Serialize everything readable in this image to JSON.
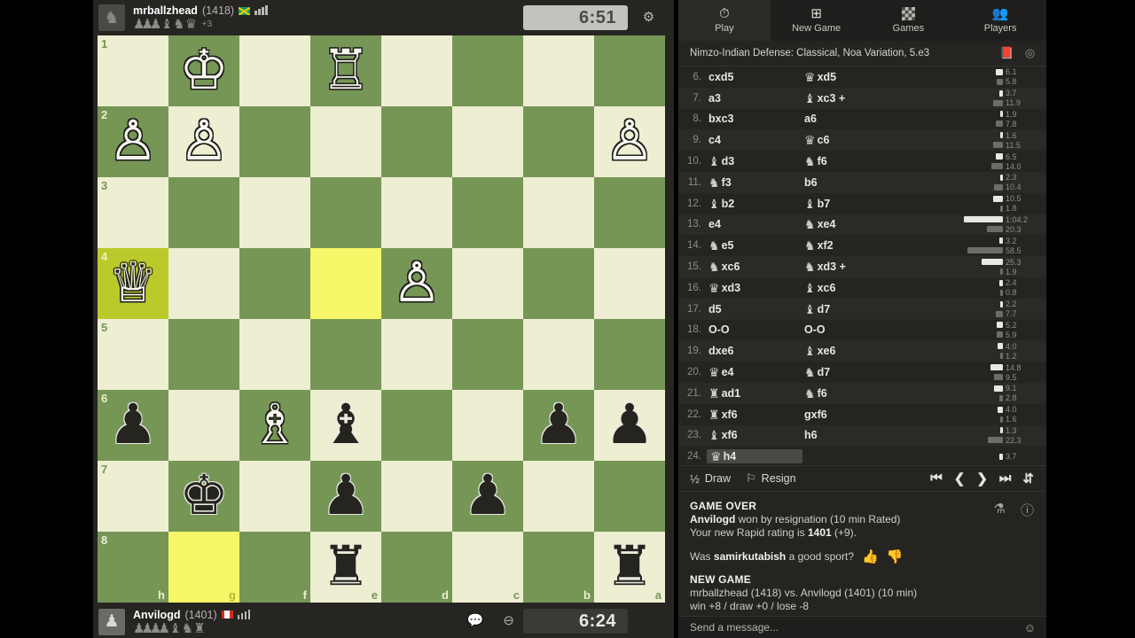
{
  "nav_tabs": [
    {
      "label": "Play",
      "icon": "stopwatch-icon",
      "active": true
    },
    {
      "label": "New Game",
      "icon": "plus-square-icon",
      "active": false
    },
    {
      "label": "Games",
      "icon": "chessboard-icon",
      "active": false
    },
    {
      "label": "Players",
      "icon": "people-icon",
      "active": false
    }
  ],
  "opening": {
    "name": "Nimzo-Indian Defense: Classical, Noa Variation, 5.e3",
    "book_icon": "book-icon",
    "analysis_icon": "compass-icon"
  },
  "players": {
    "top": {
      "name": "mrballzhead",
      "rating": "(1418)",
      "flag": "jamaica",
      "clock": "6:51",
      "clock_active": true,
      "captured": "♟♟♟ ♝ ♞ ♛",
      "advantage": "+3"
    },
    "bottom": {
      "name": "Anvilogd",
      "rating": "(1401)",
      "flag": "canada",
      "clock": "6:24",
      "clock_active": false,
      "captured": "♟♟♟♟ ♝ ♞ ♜",
      "advantage": ""
    }
  },
  "board": {
    "orientation": "black",
    "file_labels": [
      "h",
      "g",
      "f",
      "e",
      "d",
      "c",
      "b",
      "a"
    ],
    "rank_labels": [
      "1",
      "2",
      "3",
      "4",
      "5",
      "6",
      "7",
      "8"
    ],
    "highlighted": [
      "h4",
      "e4",
      "g8"
    ],
    "squares": [
      [
        null,
        "wK",
        null,
        "wR",
        null,
        null,
        null,
        null
      ],
      [
        "wP",
        "wP",
        null,
        null,
        null,
        null,
        null,
        "wP"
      ],
      [
        null,
        null,
        null,
        null,
        null,
        null,
        null,
        null
      ],
      [
        "wQ",
        null,
        null,
        null,
        "wP",
        null,
        null,
        null
      ],
      [
        null,
        null,
        null,
        null,
        null,
        null,
        null,
        null
      ],
      [
        "bP",
        null,
        "wB",
        "bB",
        null,
        null,
        "bP",
        "bP"
      ],
      [
        null,
        "bK",
        null,
        "bP",
        null,
        "bP",
        null,
        null
      ],
      [
        null,
        null,
        null,
        "bR",
        null,
        null,
        null,
        "bR"
      ]
    ]
  },
  "moves": [
    {
      "n": "6.",
      "w_pc": "",
      "w": "cxd5",
      "b_pc": "♛",
      "b": "xd5",
      "wt": "6.1",
      "bt": "5.8",
      "wbar": 8,
      "bbar": 7
    },
    {
      "n": "7.",
      "w_pc": "",
      "w": "a3",
      "b_pc": "♝",
      "b": "xc3 +",
      "wt": "3.7",
      "bt": "11.9",
      "wbar": 4,
      "bbar": 11
    },
    {
      "n": "8.",
      "w_pc": "",
      "w": "bxc3",
      "b_pc": "",
      "b": "a6",
      "wt": "1.9",
      "bt": "7.8",
      "wbar": 3,
      "bbar": 8
    },
    {
      "n": "9.",
      "w_pc": "",
      "w": "c4",
      "b_pc": "♛",
      "b": "c6",
      "wt": "1.6",
      "bt": "11.5",
      "wbar": 3,
      "bbar": 11
    },
    {
      "n": "10.",
      "w_pc": "♝",
      "w": "d3",
      "b_pc": "♞",
      "b": "f6",
      "wt": "6.5",
      "bt": "14.0",
      "wbar": 8,
      "bbar": 13
    },
    {
      "n": "11.",
      "w_pc": "♞",
      "w": "f3",
      "b_pc": "",
      "b": "b6",
      "wt": "2.3",
      "bt": "10.4",
      "wbar": 3,
      "bbar": 10
    },
    {
      "n": "12.",
      "w_pc": "♝",
      "w": "b2",
      "b_pc": "♝",
      "b": "b7",
      "wt": "10.5",
      "bt": "1.8",
      "wbar": 11,
      "bbar": 3
    },
    {
      "n": "13.",
      "w_pc": "",
      "w": "e4",
      "b_pc": "♞",
      "b": "xe4",
      "wt": "1:04.2",
      "bt": "20.3",
      "wbar": 44,
      "bbar": 18
    },
    {
      "n": "14.",
      "w_pc": "♞",
      "w": "e5",
      "b_pc": "♞",
      "b": "xf2",
      "wt": "3.2",
      "bt": "58.5",
      "wbar": 4,
      "bbar": 40
    },
    {
      "n": "15.",
      "w_pc": "♞",
      "w": "xc6",
      "b_pc": "♞",
      "b": "xd3 +",
      "wt": "25.3",
      "bt": "1.9",
      "wbar": 24,
      "bbar": 3
    },
    {
      "n": "16.",
      "w_pc": "♛",
      "w": "xd3",
      "b_pc": "♝",
      "b": "xc6",
      "wt": "2.4",
      "bt": "0.8",
      "wbar": 4,
      "bbar": 3
    },
    {
      "n": "17.",
      "w_pc": "",
      "w": "d5",
      "b_pc": "♝",
      "b": "d7",
      "wt": "2.2",
      "bt": "7.7",
      "wbar": 3,
      "bbar": 8
    },
    {
      "n": "18.",
      "w_pc": "",
      "w": "O-O",
      "b_pc": "",
      "b": "O-O",
      "wt": "5.2",
      "bt": "5.9",
      "wbar": 7,
      "bbar": 7
    },
    {
      "n": "19.",
      "w_pc": "",
      "w": "dxe6",
      "b_pc": "♝",
      "b": "xe6",
      "wt": "4.0",
      "bt": "1.2",
      "wbar": 6,
      "bbar": 3
    },
    {
      "n": "20.",
      "w_pc": "♛",
      "w": "e4",
      "b_pc": "♞",
      "b": "d7",
      "wt": "14.8",
      "bt": "9.5",
      "wbar": 14,
      "bbar": 10
    },
    {
      "n": "21.",
      "w_pc": "♜",
      "w": "ad1",
      "b_pc": "♞",
      "b": "f6",
      "wt": "9.1",
      "bt": "2.8",
      "wbar": 10,
      "bbar": 4
    },
    {
      "n": "22.",
      "w_pc": "♜",
      "w": "xf6",
      "b_pc": "",
      "b": "gxf6",
      "wt": "4.0",
      "bt": "1.6",
      "wbar": 6,
      "bbar": 3
    },
    {
      "n": "23.",
      "w_pc": "♝",
      "w": "xf6",
      "b_pc": "",
      "b": "h6",
      "wt": "1.3",
      "bt": "22.3",
      "wbar": 3,
      "bbar": 17
    },
    {
      "n": "24.",
      "w_pc": "♛",
      "w": "h4",
      "b_pc": "",
      "b": "",
      "wt": "3.7",
      "bt": "",
      "wbar": 4,
      "bbar": 0
    }
  ],
  "selected_move": "24. ♛h4",
  "actions": {
    "draw_label": "Draw",
    "draw_icon": "half-icon",
    "resign_label": "Resign",
    "resign_icon": "flag-icon",
    "nav_first": "⏮",
    "nav_prev": "❮",
    "nav_next": "❯",
    "nav_last": "⏭",
    "nav_flip": "⇵"
  },
  "game_over": {
    "title": "GAME OVER",
    "result_winner": "Anvilogd",
    "result_rest": " won by resignation (10 min Rated)",
    "rating_prefix": "Your new Rapid rating is ",
    "rating_value": "1401",
    "rating_suffix": " (+9).",
    "sport_prefix": "Was ",
    "sport_name": "samirkutabish",
    "sport_suffix": " a good sport?",
    "thumbs_up": "👍",
    "thumbs_down": "👎",
    "new_game_title": "NEW GAME",
    "new_game_players": "mrballzhead (1418) vs. Anvilogd (1401) (10 min)",
    "new_game_terms": "win +8 / draw +0 / lose -8",
    "share_icon": "share-icon",
    "info_icon": "info-icon"
  },
  "chat": {
    "placeholder": "Send a message...",
    "emoji_icon": "smiley-icon"
  },
  "colors": {
    "board_light": "#eeeed2",
    "board_dark": "#769656",
    "highlight_yellow": "#f7f769",
    "highlight_olive": "#baca2b",
    "panel_bg": "#262421"
  }
}
